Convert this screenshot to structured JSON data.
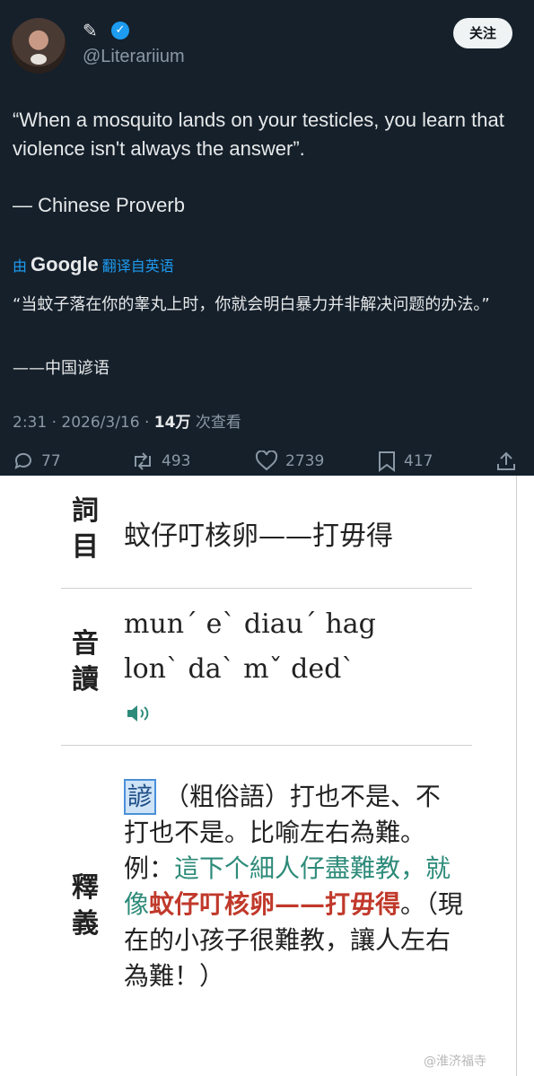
{
  "tweet": {
    "name_icon": "✎",
    "handle": "@Literariium",
    "follow_label": "关注",
    "text": "“When a mosquito lands on your testicles, you learn that violence isn't always the answer”.",
    "attribution": "— Chinese Proverb",
    "translate_prefix": "由",
    "translate_brand": "Google",
    "translate_suffix": "翻译自英语",
    "translation": "“当蚊子落在你的睾丸上时，你就会明白暴力并非解决问题的办法。”",
    "translation_attribution": "——中国谚语",
    "meta_time": "2:31 · 2026/3/16 · ",
    "meta_views": "14万",
    "meta_views_suffix": " 次查看",
    "counts": {
      "reply": "77",
      "retweet": "493",
      "like": "2739",
      "bookmark": "417"
    },
    "colors": {
      "background": "#15202b",
      "accent": "#1d9bf0"
    }
  },
  "dict": {
    "label_entry": "詞目",
    "entry": "蚊仔叮核卵——打毋得",
    "label_pron": "音讀",
    "pron_line1": "mun´ e` diau´ hag",
    "pron_line2": "lon` da` mˇ ded`",
    "label_def": "釋義",
    "def_tag": "諺",
    "def_part1": " （粗俗語）打也不是、不打也不是。比喻左右為難。　例：",
    "def_example": "這下个細人仔盡難教，就像",
    "def_highlight": "蚊仔叮核卵——打毋得",
    "def_part2": "。（現在的小孩子很難教，讓人左右為難！）",
    "colors": {
      "example": "#2e8b7a",
      "highlight": "#c0392b",
      "tag": "#4a90d9"
    }
  },
  "watermark": "@淮济福寺"
}
